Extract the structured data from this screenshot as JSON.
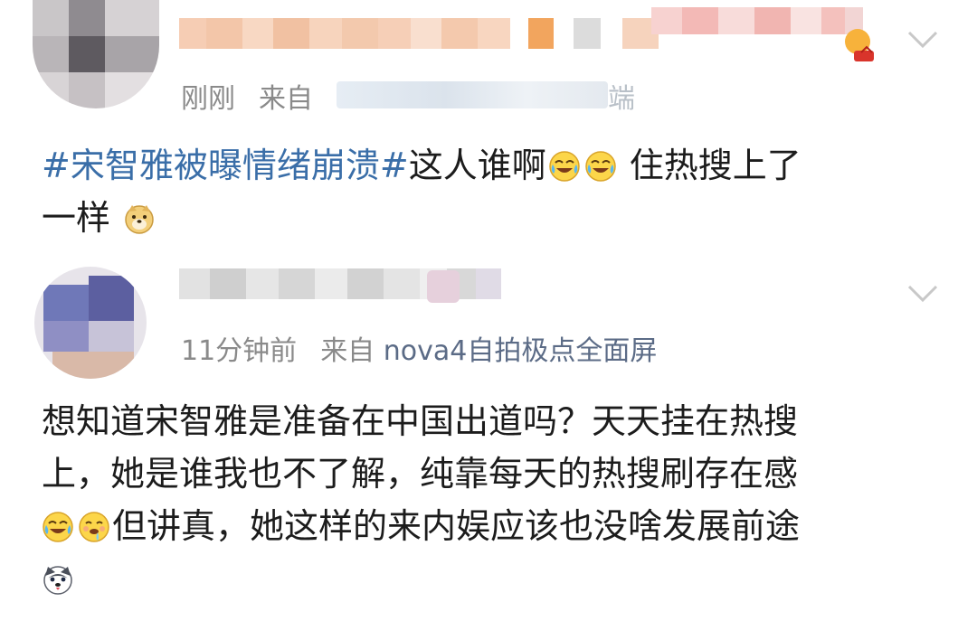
{
  "posts": [
    {
      "time": "刚刚",
      "source_prefix": "来自",
      "source_tail": "端",
      "text": {
        "hashtag": "#宋智雅被曝情绪崩溃#",
        "part1": "这人谁啊",
        "part2": " 住热搜上了",
        "line2": "一样"
      },
      "emojis": [
        "laugh-cry-icon",
        "laugh-cry-icon",
        "doge-icon"
      ]
    },
    {
      "time": "11分钟前",
      "source_prefix": "来自",
      "source": "nova4自拍极点全面屏",
      "text": {
        "line1": "想知道宋智雅是准备在中国出道吗？天天挂在热搜",
        "line2": "上，她是谁我也不了解，纯靠每天的热搜刷存在感",
        "line3": "但讲真，她这样的来内娱应该也没啥发展前途"
      },
      "emojis": [
        "laugh-cry-icon",
        "drool-icon",
        "husky-icon"
      ]
    }
  ],
  "colors": {
    "hashtag": "#3a6ea8",
    "meta": "#8a8a8a",
    "text": "#1c1c1c"
  }
}
